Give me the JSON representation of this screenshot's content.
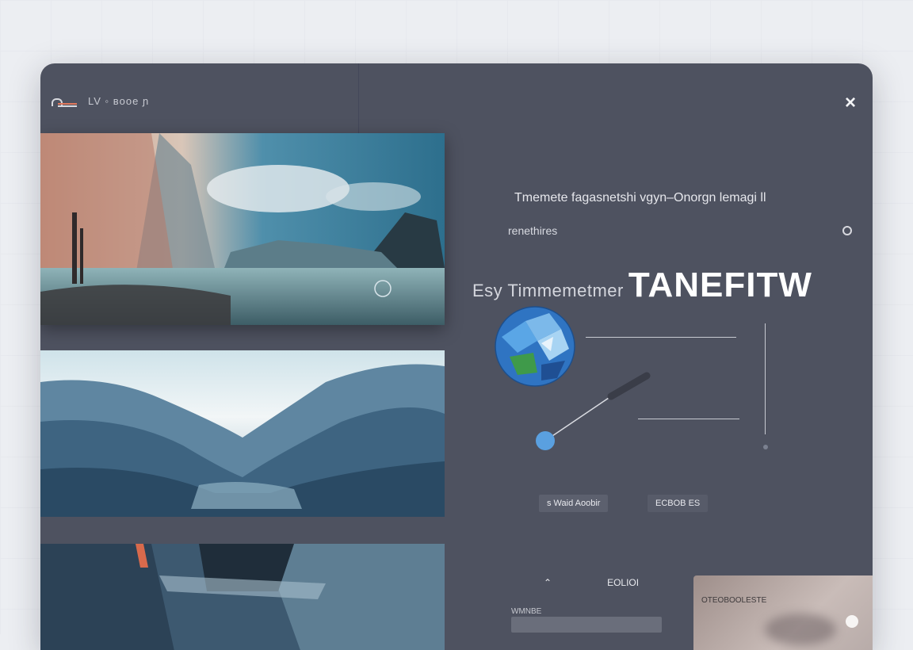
{
  "header": {
    "brand_name": "LV  ◦  ʙooe ɲ",
    "close_icon": "×"
  },
  "hero": {
    "caption_line1": "Tmemete fagasnetshi vgyn–Onorgn lemagi ll",
    "caption_line2": "renethires",
    "title_light": "Esy Timmemetmer",
    "title_bold": "TANEFITW"
  },
  "actions": {
    "left_button": "s Waid Aoobir",
    "right_button": "ECBOB ES"
  },
  "lower": {
    "arrow": "⌃",
    "label": "EOLIOI",
    "small_label": "WMNBE"
  },
  "preview": {
    "title": "OTEOBOOLESTE"
  },
  "colors": {
    "window_bg": "#4e5260",
    "page_bg": "#eceef2",
    "accent_blue": "#4a90d9"
  }
}
